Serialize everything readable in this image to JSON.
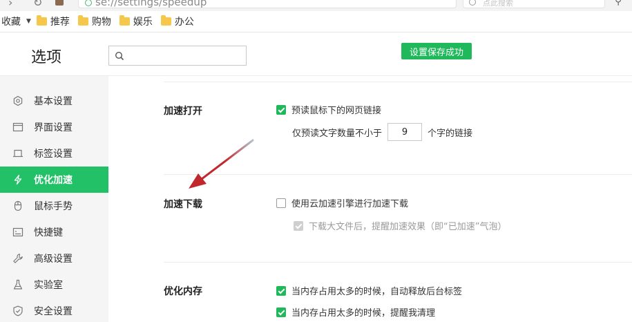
{
  "browser": {
    "address_text": "se://settings/speedup",
    "search_placeholder": "点此搜索"
  },
  "bookmarks": {
    "favorites_label": "收藏",
    "folders": [
      {
        "label": "推荐"
      },
      {
        "label": "购物"
      },
      {
        "label": "娱乐"
      },
      {
        "label": "办公"
      }
    ]
  },
  "header": {
    "title": "选项",
    "search_placeholder": "",
    "toast": "设置保存成功"
  },
  "sidebar": {
    "items": [
      {
        "label": "基本设置",
        "icon": "gear-icon"
      },
      {
        "label": "界面设置",
        "icon": "window-icon"
      },
      {
        "label": "标签设置",
        "icon": "tab-icon"
      },
      {
        "label": "优化加速",
        "icon": "lightning-icon",
        "active": true
      },
      {
        "label": "鼠标手势",
        "icon": "mouse-icon"
      },
      {
        "label": "快捷键",
        "icon": "keyboard-icon"
      },
      {
        "label": "高级设置",
        "icon": "wrench-icon"
      },
      {
        "label": "实验室",
        "icon": "flask-icon"
      },
      {
        "label": "安全设置",
        "icon": "shield-icon"
      }
    ]
  },
  "sections": {
    "open": {
      "title": "加速打开",
      "preload_label": "预读鼠标下的网页链接",
      "preload_checked": true,
      "min_chars_prefix": "仅预读文字数量不小于",
      "min_chars_value": "9",
      "min_chars_suffix": "个字的链接"
    },
    "download": {
      "title": "加速下载",
      "cloud_label": "使用云加速引擎进行加速下载",
      "cloud_checked": false,
      "bubble_label": "下载大文件后，提醒加速效果（即“已加速”气泡）",
      "bubble_checked": true,
      "bubble_disabled": true
    },
    "memory": {
      "title": "优化内存",
      "auto_release_label": "当内存占用太多的时候，自动释放后台标签",
      "auto_release_checked": true,
      "remind_label": "当内存占用太多的时候，提醒我清理",
      "remind_checked": true
    }
  },
  "colors": {
    "accent": "#22c167",
    "toast": "#1fb85a",
    "annotation_arrow": "#c0282c"
  }
}
